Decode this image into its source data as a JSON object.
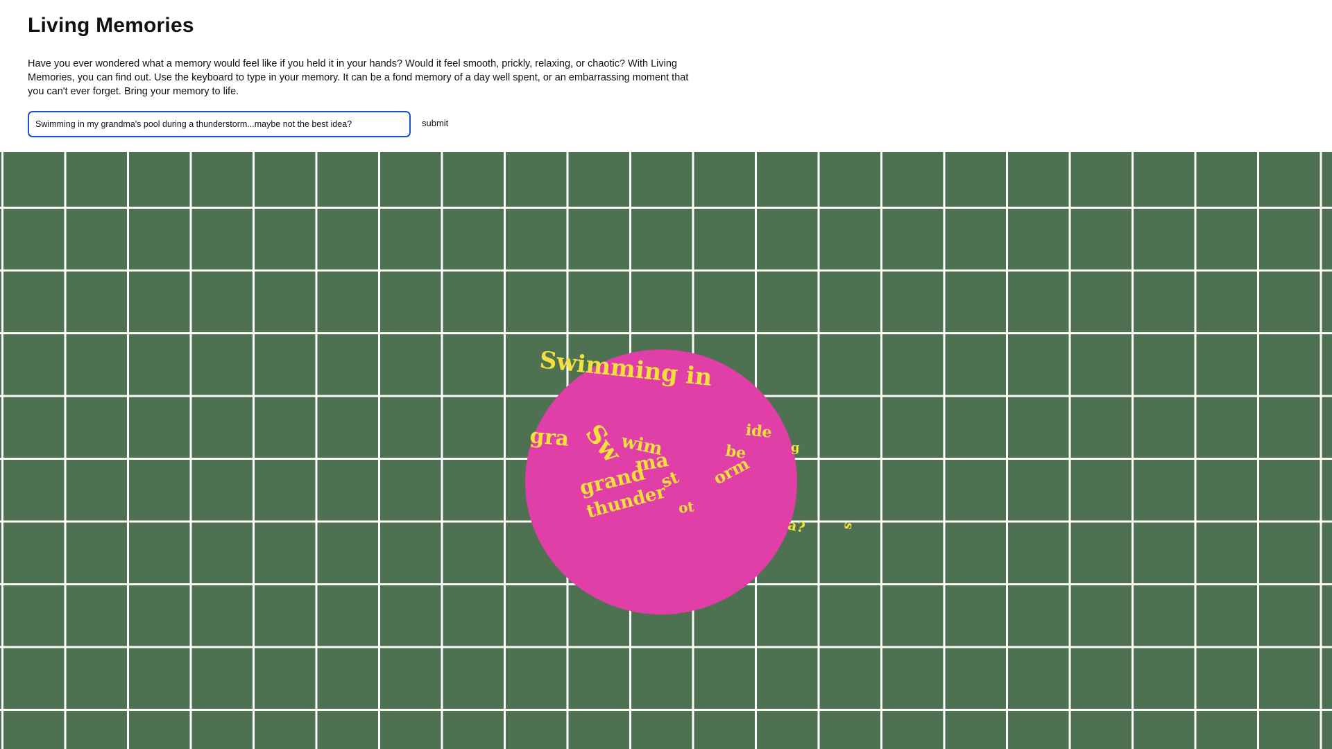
{
  "app": {
    "title": "Living Memories",
    "description": "Have you ever wondered what a memory would feel like if you held it in your hands? Would it feel smooth, prickly, relaxing, or chaotic? With Living Memories, you can find out. Use the keyboard to type in your memory. It can be a fond memory of a day well spent, or an embarrassing moment that you can't ever forget. Bring your memory to life."
  },
  "form": {
    "input_value": "Swimming in my grandma's pool during a thunderstorm...maybe not the best idea?",
    "submit_label": "submit"
  },
  "visual": {
    "background_color": "#4e7251",
    "grid_line_color": "#ffffff",
    "orb_color": "#e13fa8",
    "text_color": "#f4e03c",
    "floating_words": [
      "Swimming in",
      "gra",
      "Sw",
      "wim",
      "ma",
      "grand",
      "thunder",
      "st",
      "orm",
      "be",
      "ot",
      "ide",
      "a?",
      "g",
      "s"
    ]
  }
}
